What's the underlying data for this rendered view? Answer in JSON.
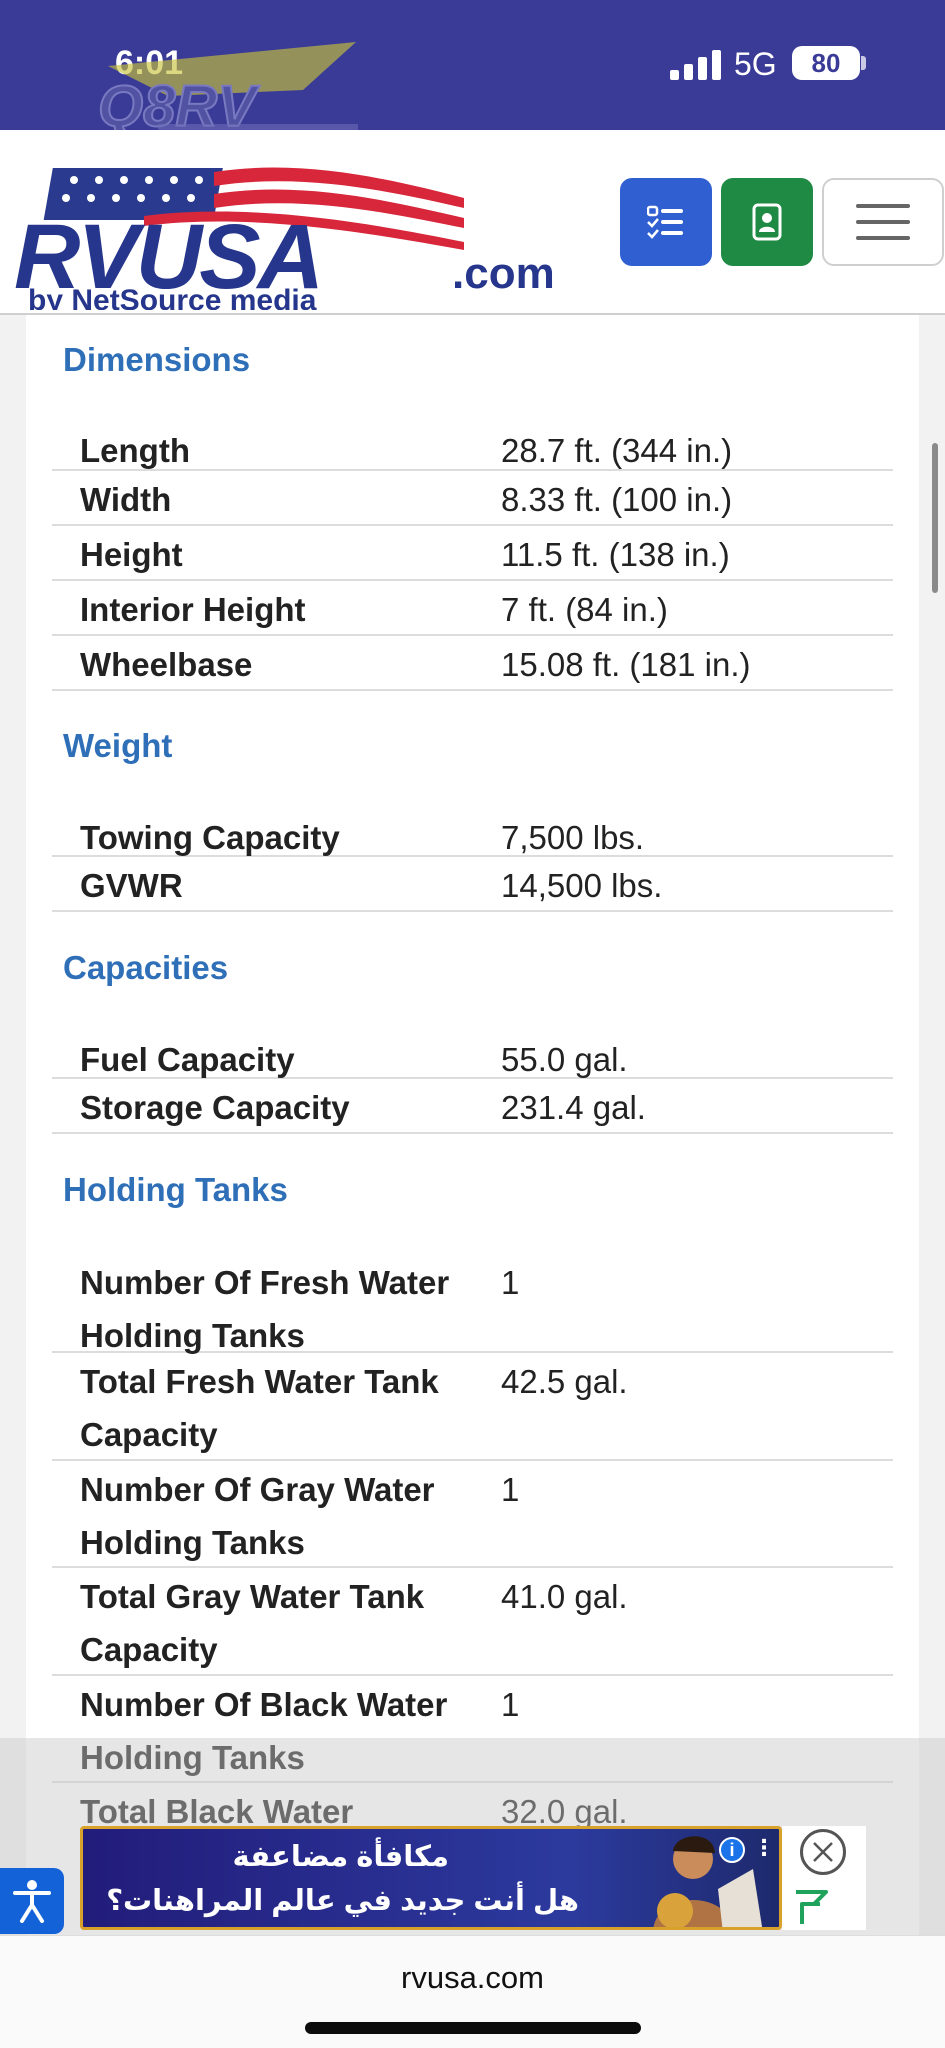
{
  "status_bar": {
    "time": "6:01",
    "network": "5G",
    "battery": "80",
    "watermark_text": "Q8RV"
  },
  "header": {
    "logo_text": "RVUSA",
    "logo_domain": ".com",
    "logo_byline": "by NetSource media",
    "compare_icon": "checklist-icon",
    "contact_icon": "contact-card-icon",
    "menu_icon": "hamburger-icon"
  },
  "sections": [
    {
      "title": "Dimensions",
      "rows": [
        {
          "label": "Length",
          "value": "28.7 ft. (344 in.)"
        },
        {
          "label": "Width",
          "value": "8.33 ft. (100 in.)"
        },
        {
          "label": "Height",
          "value": "11.5 ft. (138 in.)"
        },
        {
          "label": "Interior Height",
          "value": "7 ft. (84 in.)"
        },
        {
          "label": "Wheelbase",
          "value": "15.08 ft. (181 in.)"
        }
      ]
    },
    {
      "title": "Weight",
      "rows": [
        {
          "label": "Towing Capacity",
          "value": "7,500 lbs."
        },
        {
          "label": "GVWR",
          "value": "14,500 lbs."
        }
      ]
    },
    {
      "title": "Capacities",
      "rows": [
        {
          "label": "Fuel Capacity",
          "value": "55.0 gal."
        },
        {
          "label": "Storage Capacity",
          "value": "231.4 gal."
        }
      ]
    },
    {
      "title": "Holding Tanks",
      "rows": [
        {
          "label": "Number Of Fresh Water Holding Tanks",
          "value": "1"
        },
        {
          "label": "Total Fresh Water Tank Capacity",
          "value": "42.5 gal."
        },
        {
          "label": "Number Of Gray Water Holding Tanks",
          "value": "1"
        },
        {
          "label": "Total Gray Water Tank Capacity",
          "value": "41.0 gal."
        },
        {
          "label": "Number Of Black Water Holding Tanks",
          "value": "1"
        },
        {
          "label": "Total Black Water",
          "value": "32.0 gal."
        }
      ]
    }
  ],
  "ad": {
    "line1": "مكافأة مضاعفة",
    "line2": "هل أنت جديد في عالم المراهنات؟",
    "info": "i",
    "more": "⋮"
  },
  "browser": {
    "url": "rvusa.com"
  },
  "colors": {
    "status_bar": "#3a3b97",
    "section_title": "#2e6fb8",
    "compare_button": "#2f5fd0",
    "contact_button": "#1f8a44",
    "accessibility_button": "#1462d8"
  }
}
